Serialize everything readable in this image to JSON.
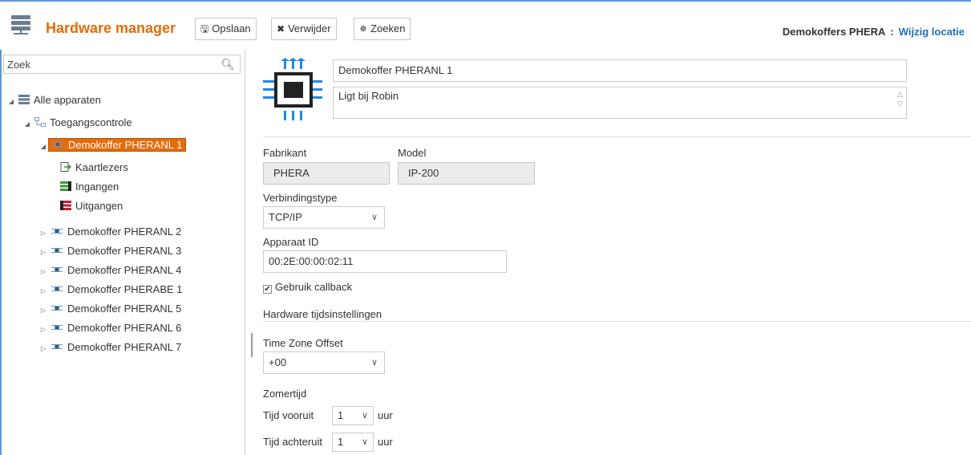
{
  "header": {
    "title": "Hardware manager",
    "buttons": {
      "save": "Opslaan",
      "delete": "Verwijder",
      "search": "Zoeken"
    },
    "location_name": "Demokoffers PHERA",
    "location_sep": ":",
    "change_location": "Wijzig locatie"
  },
  "sidebar": {
    "search_placeholder": "Zoek",
    "tree": {
      "root": "Alle apparaten",
      "group": "Toegangscontrole",
      "selected": "Demokoffer PHERANL 1",
      "children": [
        "Kaartlezers",
        "Ingangen",
        "Uitgangen"
      ],
      "devices": [
        "Demokoffer PHERANL 2",
        "Demokoffer PHERANL 3",
        "Demokoffer PHERANL 4",
        "Demokoffer PHERABE 1",
        "Demokoffer PHERANL 5",
        "Demokoffer PHERANL 6",
        "Demokoffer PHERANL 7"
      ]
    }
  },
  "main": {
    "name": "Demokoffer PHERANL 1",
    "description": "Ligt bij Robin",
    "manufacturer_label": "Fabrikant",
    "manufacturer": "PHERA",
    "model_label": "Model",
    "model": "IP-200",
    "connection_label": "Verbindingstype",
    "connection": "TCP/IP",
    "device_id_label": "Apparaat ID",
    "device_id": "00:2E:00:00:02:11",
    "callback_label": "Gebruik callback",
    "callback_checked": true,
    "time_settings_label": "Hardware tijdsinstellingen",
    "tz_label": "Time Zone Offset",
    "tz": "+00",
    "dst_label": "Zomertijd",
    "forward_label": "Tijd vooruit",
    "forward": "1",
    "back_label": "Tijd achteruit",
    "back": "1",
    "unit": "uur"
  },
  "colors": {
    "accent": "#e46c0a",
    "link": "#1f6fba",
    "frame": "#5b9bd5"
  },
  "icons": [
    "server-icon",
    "save-icon",
    "close-icon",
    "spinner-icon",
    "search-icon",
    "chip-icon",
    "network-icon",
    "card-reader-icon",
    "input-icon",
    "output-icon",
    "checkbox-icon",
    "chevron-down-icon"
  ]
}
